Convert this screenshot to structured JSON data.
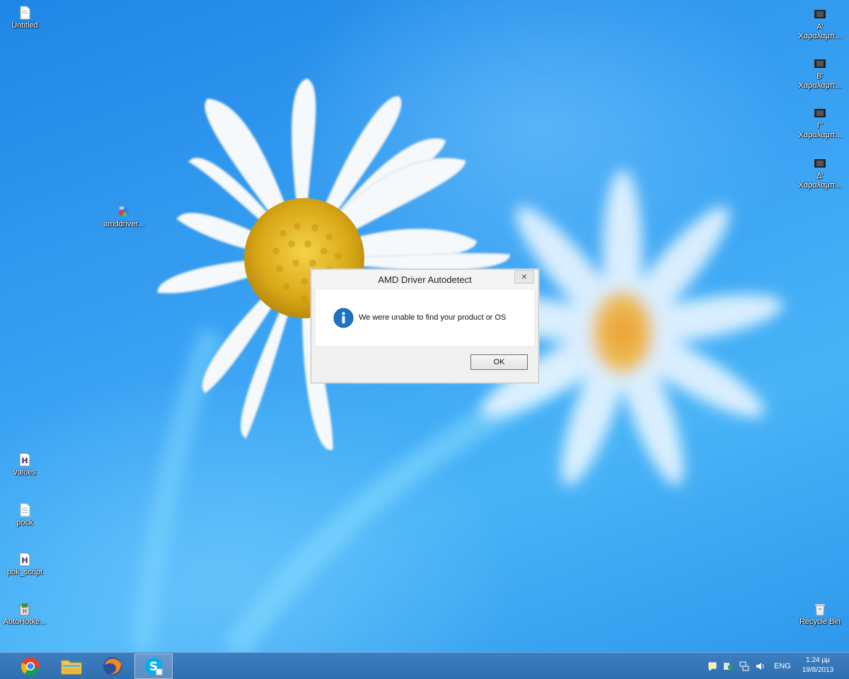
{
  "desktop": {
    "icons_left": [
      {
        "label": "Untitled",
        "icon": "document-icon"
      },
      {
        "label": "amddriver...",
        "icon": "amd-installer-icon"
      },
      {
        "label": "values",
        "icon": "ahk-script-icon"
      },
      {
        "label": "pock",
        "icon": "document-icon"
      },
      {
        "label": "pok_script",
        "icon": "ahk-script-icon"
      },
      {
        "label": "AutoHotke...",
        "icon": "autohotkey-icon"
      }
    ],
    "icons_right": [
      {
        "line1": "Α'",
        "line2": "Χαραλαμπ...",
        "icon": "video-file-icon"
      },
      {
        "line1": "Β'",
        "line2": "Χαραλαμπ...",
        "icon": "video-file-icon"
      },
      {
        "line1": "Γ'",
        "line2": "Χαραλαμπ...",
        "icon": "video-file-icon"
      },
      {
        "line1": "Δ'",
        "line2": "Χαραλαμπ...",
        "icon": "video-file-icon"
      }
    ],
    "recycle_bin": {
      "label": "Recycle Bin",
      "icon": "recycle-bin-icon"
    }
  },
  "dialog": {
    "title": "AMD Driver Autodetect",
    "close_glyph": "✕",
    "message": "We were unable to find your product or OS",
    "ok_label": "OK",
    "icon": "information-icon",
    "accent_color": "#1e72c6"
  },
  "taskbar": {
    "pinned": [
      {
        "name": "chrome",
        "icon": "chrome-icon"
      },
      {
        "name": "file-explorer",
        "icon": "folder-icon"
      },
      {
        "name": "firefox",
        "icon": "firefox-icon"
      },
      {
        "name": "skype",
        "icon": "skype-icon",
        "active": true
      }
    ],
    "tray": {
      "icons": [
        "action-center-icon",
        "security-icon",
        "network-icon",
        "volume-icon"
      ],
      "language": "ENG",
      "time": "1:24 μμ",
      "date": "19/8/2013"
    }
  }
}
